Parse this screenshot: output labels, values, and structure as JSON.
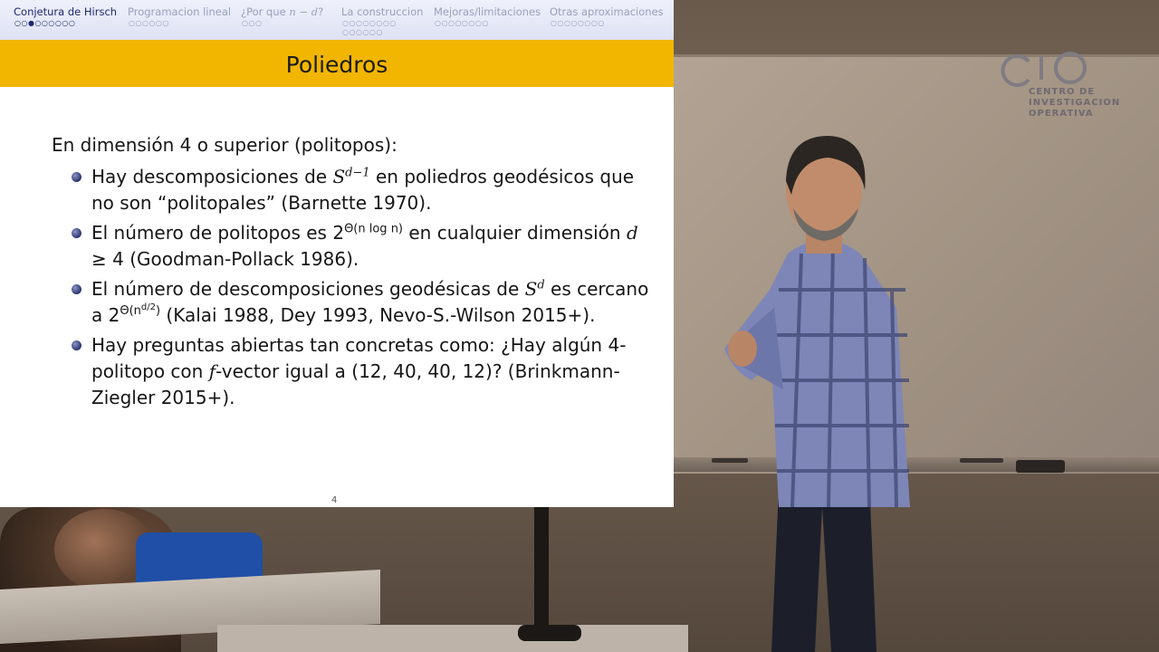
{
  "navigation": {
    "sections": [
      {
        "label": "Conjetura de Hirsch",
        "dots": "○○●○○○○○○",
        "active": true
      },
      {
        "label": "Programacion lineal",
        "dots": "○○○○○○",
        "active": false
      },
      {
        "label_prefix": "¿Por que ",
        "label_math": "n − d",
        "label_suffix": "?",
        "dots": "○○○",
        "active": false
      },
      {
        "label": "La construccion",
        "dots": "○○○○○○○○",
        "dots2": "○○○○○○",
        "active": false
      },
      {
        "label": "Mejoras/limitaciones",
        "dots": "○○○○○○○○",
        "active": false
      },
      {
        "label": "Otras aproximaciones",
        "dots": "○○○○○○○○",
        "active": false
      }
    ]
  },
  "slide": {
    "title": "Poliedros",
    "intro": "En dimensión 4 o superior (politopos):",
    "items": [
      {
        "t1": "Hay descomposiciones de ",
        "m1": "S",
        "sup1": "d−1",
        "t2": " en poliedros geodésicos que no son “politopales” (Barnette 1970)."
      },
      {
        "t1": "El número de politopos es 2",
        "sup1": "Θ(n log n)",
        "t2": " en cualquier dimensión ",
        "m1": "d",
        "t3": " ≥ 4 (Goodman-Pollack 1986)."
      },
      {
        "t1": "El número de descomposiciones geodésicas de ",
        "m1": "S",
        "sup1": "d",
        "t2": " es cercano a 2",
        "sup2": "Θ(n",
        "sup2b": "d/2",
        "sup2c": ")",
        "t3": " (Kalai 1988, Dey 1993, Nevo-S.-Wilson 2015+)."
      },
      {
        "t1": "Hay preguntas abiertas tan concretas como: ¿Hay algún 4-politopo con ",
        "m1": "f",
        "t2": "-vector igual a (12, 40, 40, 12)? (Brinkmann-Ziegler 2015+)."
      }
    ],
    "page_number": "4"
  },
  "background": {
    "logo_text_lines": [
      "CENTRO DE",
      "INVESTIGACION",
      "OPERATIVA"
    ]
  }
}
